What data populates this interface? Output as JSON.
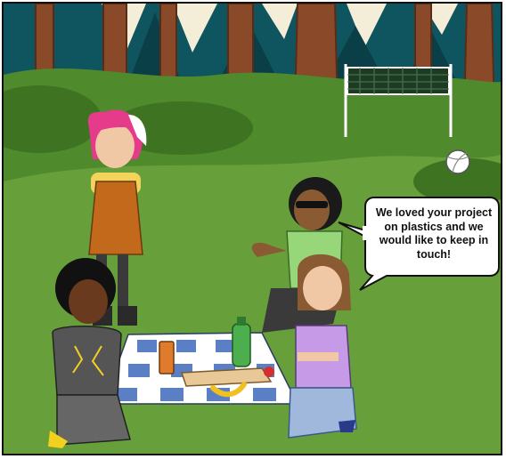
{
  "scene": {
    "setting": "forest-picnic-clearing",
    "colors": {
      "sky": "#0f5560",
      "grass": "#4f8a2c",
      "tree_trunk": "#8a4a2a",
      "blanket_blue": "#5b7fc4"
    }
  },
  "speech_bubble": {
    "text": "We loved your project on plastics and we would like to keep in touch!"
  }
}
